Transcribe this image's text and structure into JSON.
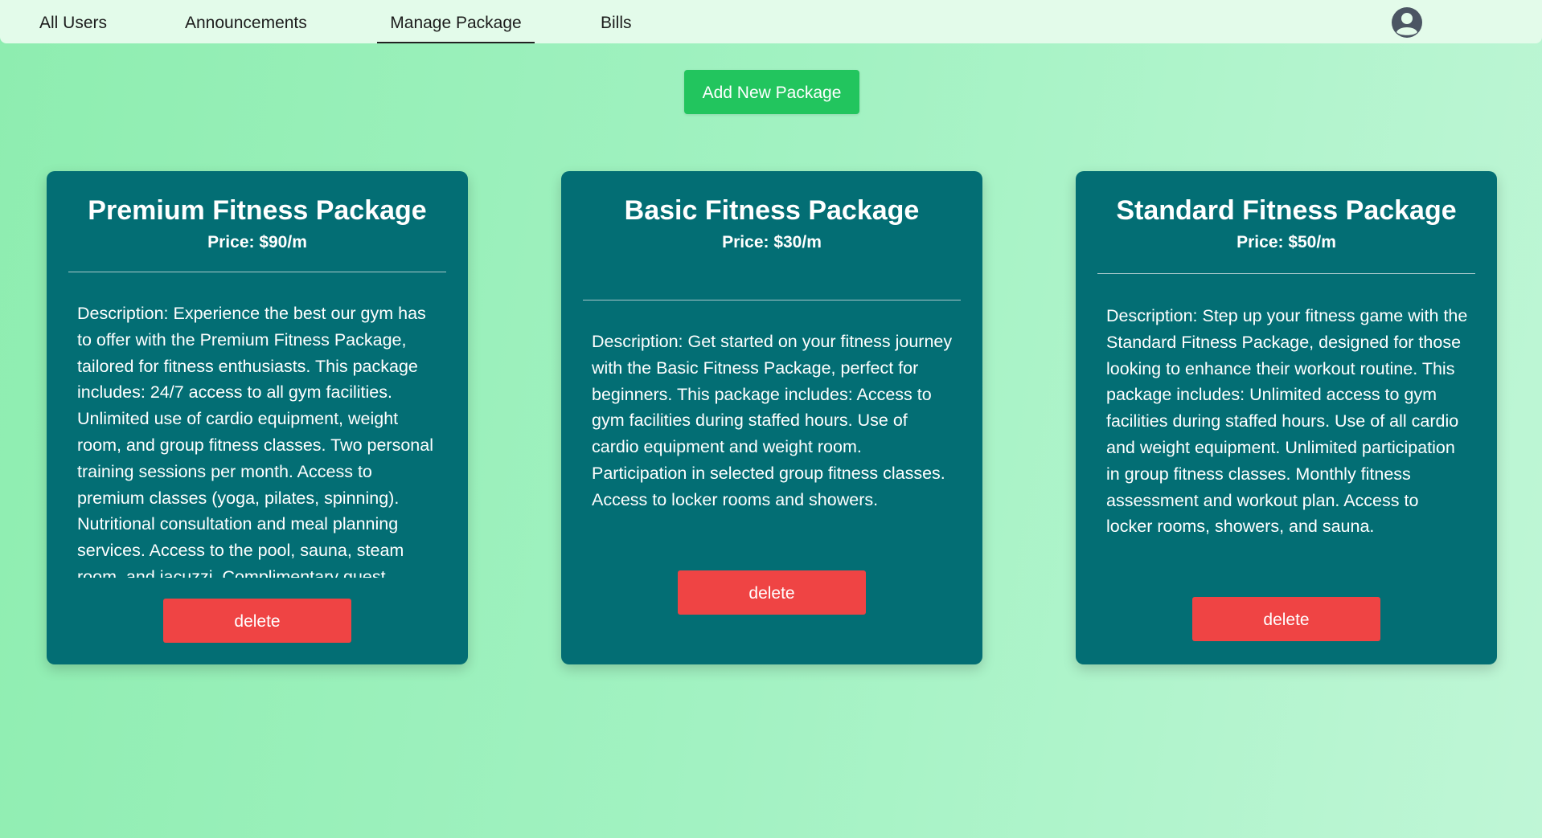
{
  "nav": {
    "items": [
      {
        "label": "All Users"
      },
      {
        "label": "Announcements"
      },
      {
        "label": "Manage Package",
        "active": true
      },
      {
        "label": "Bills"
      }
    ],
    "avatar_icon": "user-circle-icon"
  },
  "actions": {
    "add_label": "Add New Package"
  },
  "packages": [
    {
      "title": "Premium Fitness Package",
      "price": "Price: $90/m",
      "description": "Description: Experience the best our gym has to offer with the Premium Fitness Package, tailored for fitness enthusiasts. This package includes: 24/7 access to all gym facilities. Unlimited use of cardio equipment, weight room, and group fitness classes. Two personal training sessions per month. Access to premium classes (yoga, pilates, spinning). Nutritional consultation and meal planning services. Access to the pool, sauna, steam room, and jacuzzi. Complimentary guest",
      "delete_label": "delete"
    },
    {
      "title": "Basic Fitness Package",
      "price": "Price: $30/m",
      "description": "Description: Get started on your fitness journey with the Basic Fitness Package, perfect for beginners. This package includes: Access to gym facilities during staffed hours. Use of cardio equipment and weight room. Participation in selected group fitness classes. Access to locker rooms and showers.",
      "delete_label": "delete"
    },
    {
      "title": "Standard Fitness Package",
      "price": "Price: $50/m",
      "description": "Description: Step up your fitness game with the Standard Fitness Package, designed for those looking to enhance their workout routine. This package includes: Unlimited access to gym facilities during staffed hours. Use of all cardio and weight equipment. Unlimited participation in group fitness classes. Monthly fitness assessment and workout plan. Access to locker rooms, showers, and sauna.",
      "delete_label": "delete"
    }
  ],
  "colors": {
    "card_bg": "#036e74",
    "add_button": "#22c55e",
    "delete_button": "#ef4444",
    "navbar_bg": "#e3fbea"
  }
}
